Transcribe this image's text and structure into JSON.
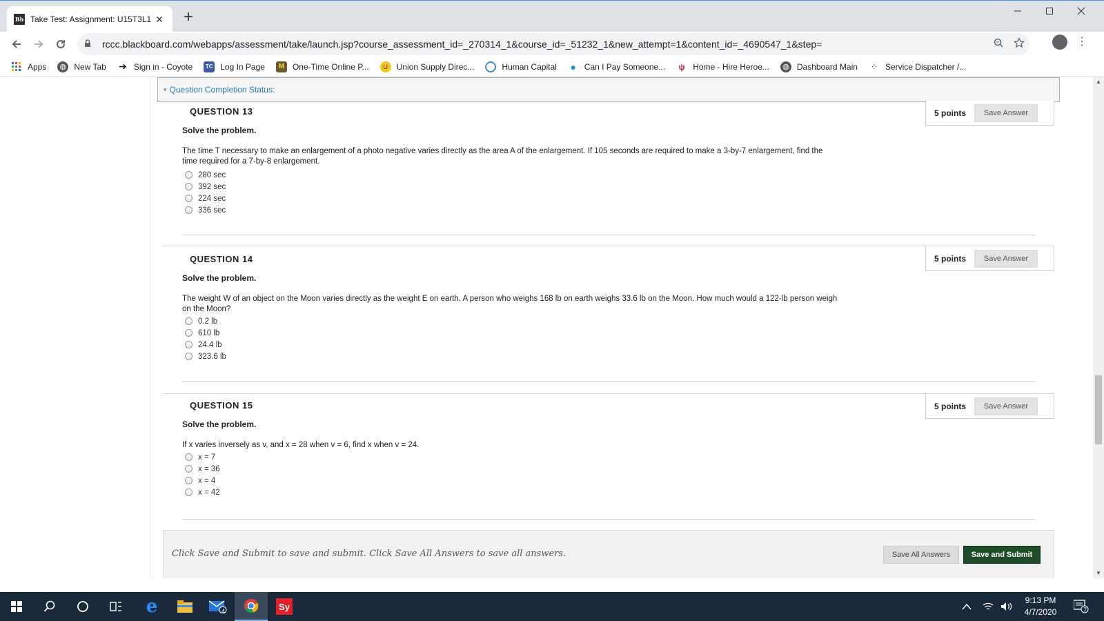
{
  "browser": {
    "tab_favicon": "Bb",
    "tab_title": "Take Test: Assignment: U15T3L1 -",
    "tab_close": "✕",
    "new_tab": "+",
    "url": "rccc.blackboard.com/webapps/assessment/take/launch.jsp?course_assessment_id=_270314_1&course_id=_51232_1&new_attempt=1&content_id=_4690547_1&step=",
    "bookmarks": [
      {
        "label": "Apps",
        "icon": "apps-grid-icon"
      },
      {
        "label": "New Tab",
        "icon": "globe-icon"
      },
      {
        "label": "Sign in - Coyote",
        "icon": "coyote-arrow-icon"
      },
      {
        "label": "Log In Page",
        "icon": "tc-icon"
      },
      {
        "label": "One-Time Online P...",
        "icon": "m-logo-icon"
      },
      {
        "label": "Union Supply Direc...",
        "icon": "union-supply-icon"
      },
      {
        "label": "Human Capital",
        "icon": "human-capital-icon"
      },
      {
        "label": "Can I Pay Someone...",
        "icon": "pin-icon"
      },
      {
        "label": "Home - Hire Heroe...",
        "icon": "hire-heroes-icon"
      },
      {
        "label": "Dashboard Main",
        "icon": "globe-icon"
      },
      {
        "label": "Service Dispatcher /...",
        "icon": "dispatcher-icon"
      }
    ]
  },
  "page": {
    "status_label": "Question Completion Status:",
    "questions": [
      {
        "title": "QUESTION 13",
        "points": "5 points",
        "save_label": "Save Answer",
        "instruction": "Solve the problem.",
        "text": "The time T necessary to make an enlargement of a photo negative varies directly as the area A of the enlargement. If 105 seconds are required to make a 3-by-7 enlargement, find the time required for a 7-by-8 enlargement.",
        "answers": [
          "280 sec",
          "392 sec",
          "224 sec",
          "336 sec"
        ]
      },
      {
        "title": "QUESTION 14",
        "points": "5 points",
        "save_label": "Save Answer",
        "instruction": "Solve the problem.",
        "text": "The weight W of an object on the Moon varies directly as the weight E on earth. A person who weighs 168 lb on earth weighs 33.6 lb on the Moon. How much would a 122-lb person weigh on the Moon?",
        "answers": [
          "0.2 lb",
          "610 lb",
          "24.4 lb",
          "323.6 lb"
        ]
      },
      {
        "title": "QUESTION 15",
        "points": "5 points",
        "save_label": "Save Answer",
        "instruction": "Solve the problem.",
        "text": "If x varies inversely as v, and x = 28 when v = 6, find x when v = 24.",
        "answers": [
          "x = 7",
          "x = 36",
          "x = 4",
          "x = 42"
        ]
      }
    ],
    "submit_message": "Click Save and Submit to save and submit. Click Save All Answers to save all answers.",
    "save_all_label": "Save All Answers",
    "submit_label": "Save and Submit"
  },
  "taskbar": {
    "time": "9:13 PM",
    "date": "4/7/2020",
    "mail_badge": "4",
    "notification_badge": "7",
    "sy_label": "Sy"
  },
  "colors": {
    "accent_link": "#2a7ab0",
    "submit_button": "#1f4d2a",
    "taskbar": "#1b2a3a"
  }
}
